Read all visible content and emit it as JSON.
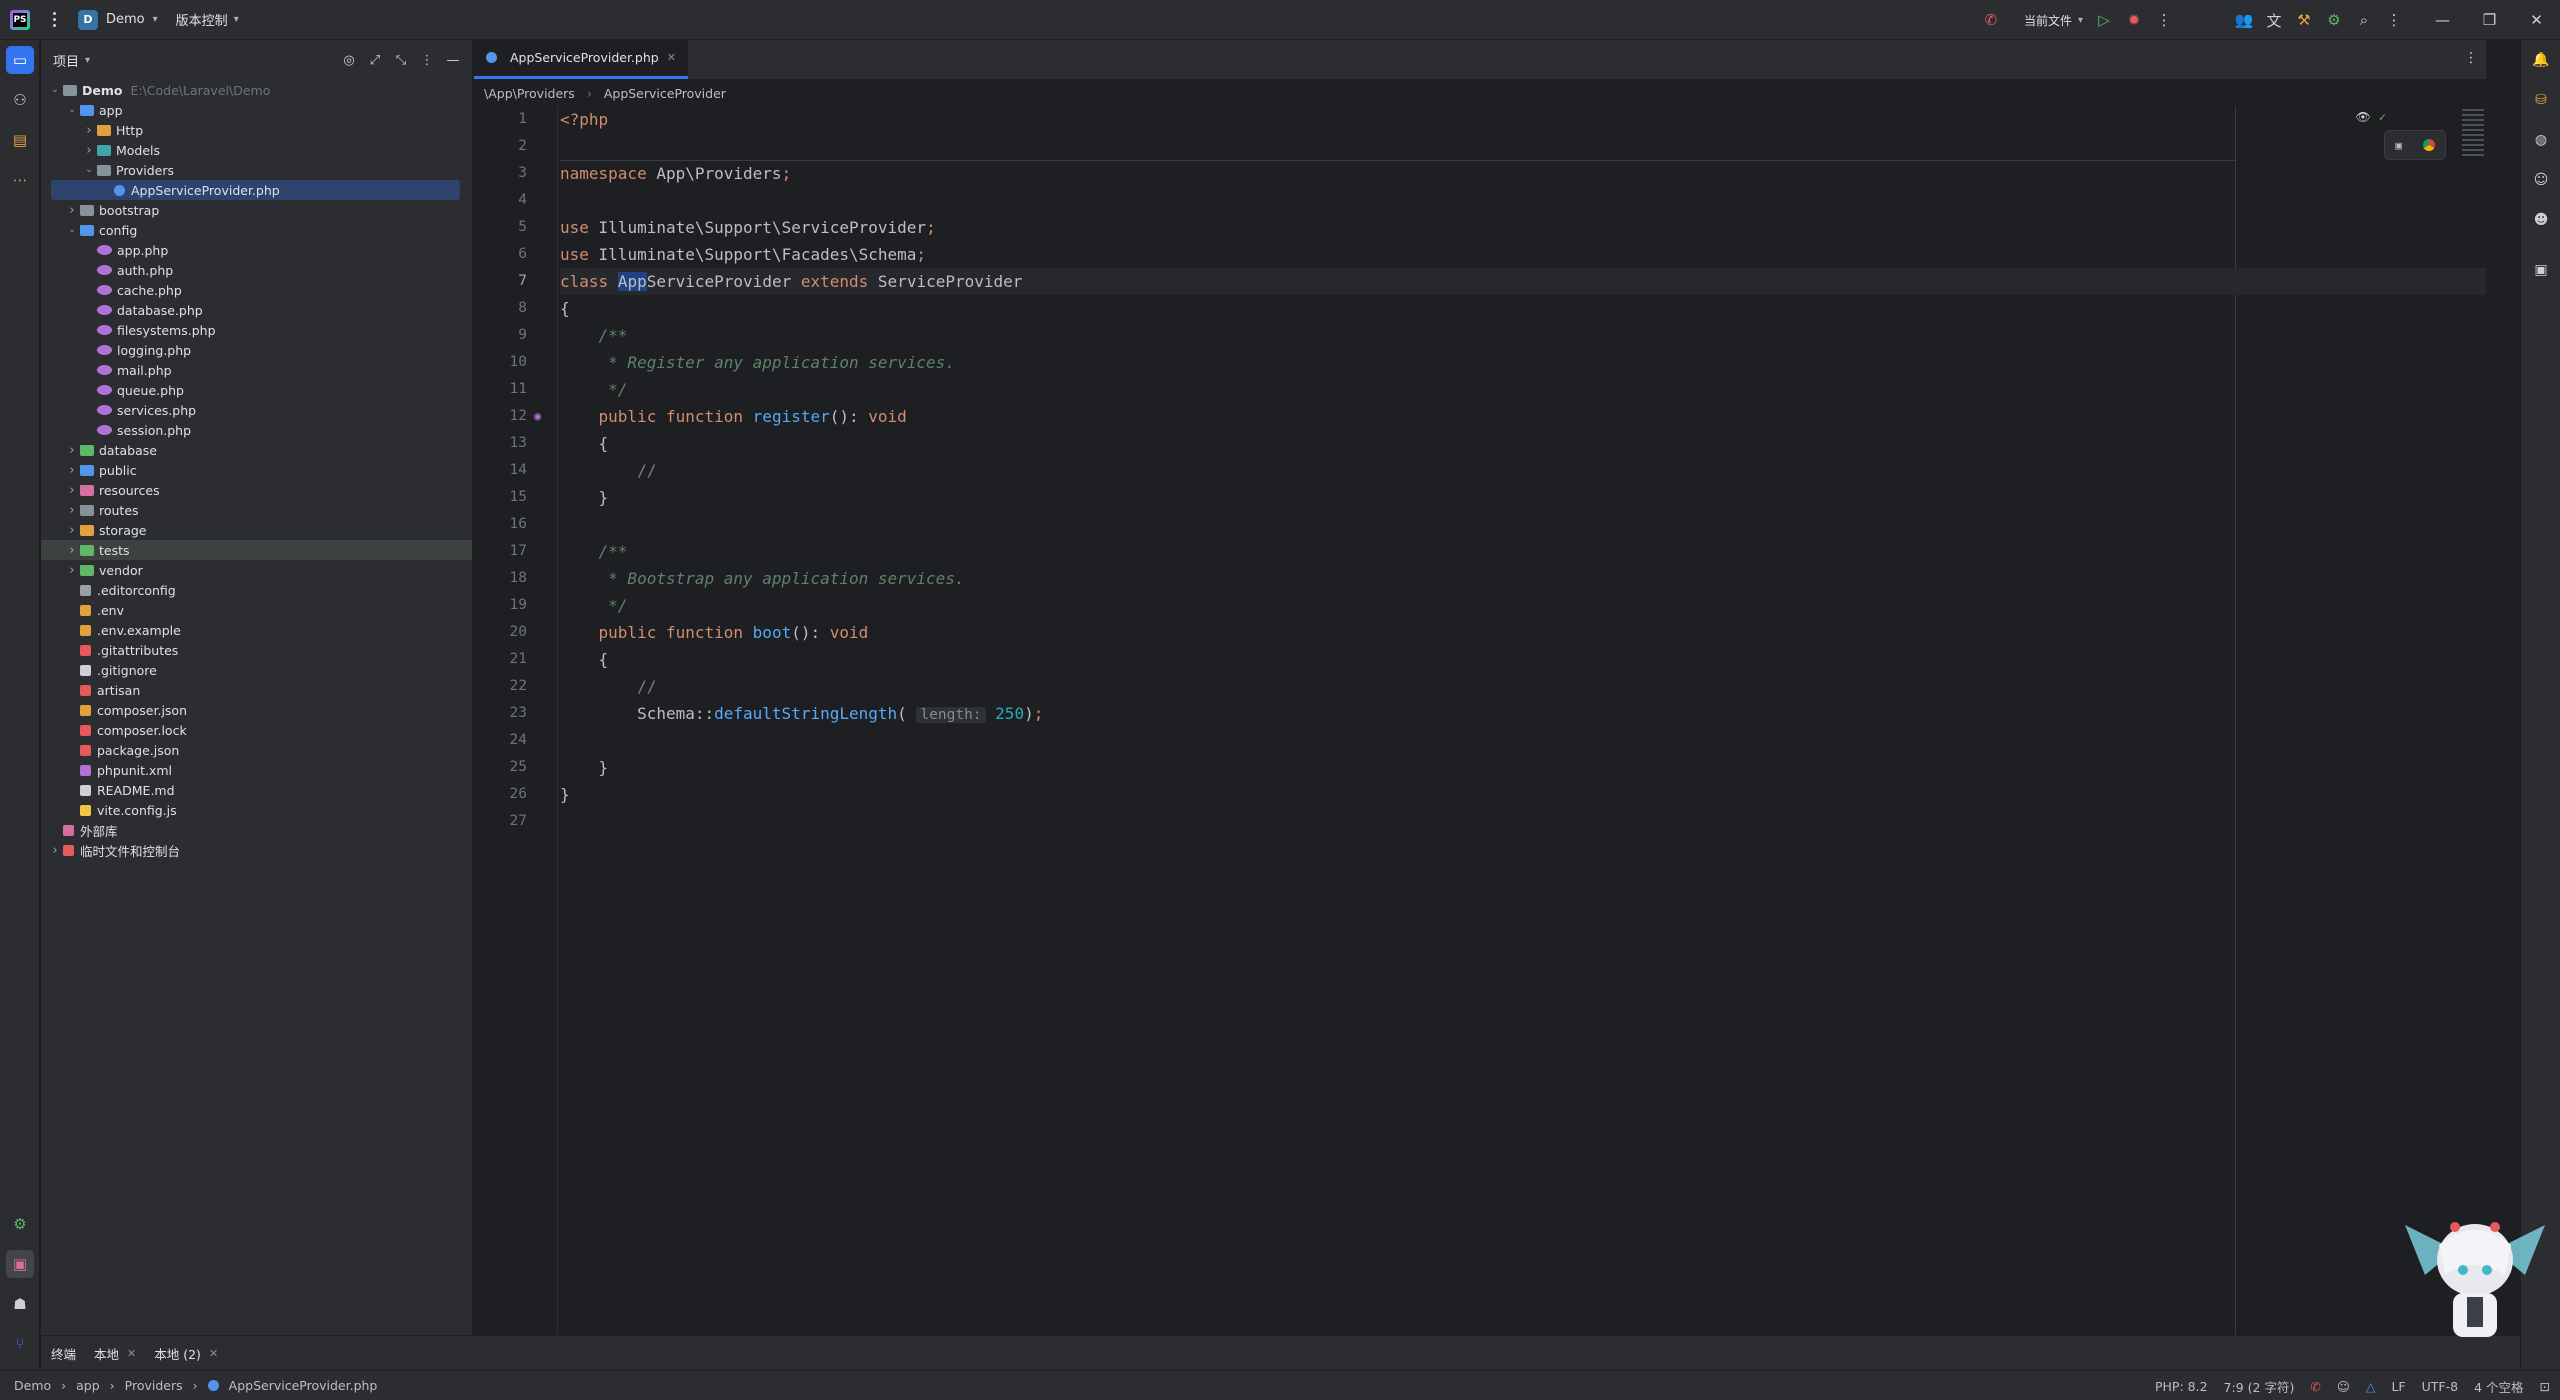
{
  "titlebar": {
    "project_badge": "D",
    "project_name": "Demo",
    "vcs_label": "版本控制",
    "run_config": "当前文件"
  },
  "project_panel": {
    "title": "项目",
    "root_name": "Demo",
    "root_path": "E:\\Code\\Laravel\\Demo",
    "tree": [
      {
        "label": "app",
        "depth": 1,
        "icon": "folder-blue",
        "expanded": true
      },
      {
        "label": "Http",
        "depth": 2,
        "icon": "folder-orange",
        "expanded": false
      },
      {
        "label": "Models",
        "depth": 2,
        "icon": "folder-teal",
        "expanded": false
      },
      {
        "label": "Providers",
        "depth": 2,
        "icon": "folder",
        "expanded": true
      },
      {
        "label": "AppServiceProvider.php",
        "depth": 3,
        "icon": "php-class",
        "selected": true
      },
      {
        "label": "bootstrap",
        "depth": 1,
        "icon": "folder",
        "expanded": false
      },
      {
        "label": "config",
        "depth": 1,
        "icon": "folder-blue",
        "expanded": true
      },
      {
        "label": "app.php",
        "depth": 2,
        "icon": "php"
      },
      {
        "label": "auth.php",
        "depth": 2,
        "icon": "php"
      },
      {
        "label": "cache.php",
        "depth": 2,
        "icon": "php"
      },
      {
        "label": "database.php",
        "depth": 2,
        "icon": "php"
      },
      {
        "label": "filesystems.php",
        "depth": 2,
        "icon": "php"
      },
      {
        "label": "logging.php",
        "depth": 2,
        "icon": "php"
      },
      {
        "label": "mail.php",
        "depth": 2,
        "icon": "php"
      },
      {
        "label": "queue.php",
        "depth": 2,
        "icon": "php"
      },
      {
        "label": "services.php",
        "depth": 2,
        "icon": "php"
      },
      {
        "label": "session.php",
        "depth": 2,
        "icon": "php"
      },
      {
        "label": "database",
        "depth": 1,
        "icon": "folder-green",
        "expanded": false
      },
      {
        "label": "public",
        "depth": 1,
        "icon": "folder-blue",
        "expanded": false
      },
      {
        "label": "resources",
        "depth": 1,
        "icon": "folder-pink",
        "expanded": false
      },
      {
        "label": "routes",
        "depth": 1,
        "icon": "folder",
        "expanded": false
      },
      {
        "label": "storage",
        "depth": 1,
        "icon": "folder-orange",
        "expanded": false
      },
      {
        "label": "tests",
        "depth": 1,
        "icon": "folder-green",
        "expanded": false,
        "highlight": true
      },
      {
        "label": "vendor",
        "depth": 1,
        "icon": "folder-green",
        "expanded": false
      },
      {
        "label": ".editorconfig",
        "depth": 1,
        "icon": "settings-file"
      },
      {
        "label": ".env",
        "depth": 1,
        "icon": "env-file"
      },
      {
        "label": ".env.example",
        "depth": 1,
        "icon": "env-file"
      },
      {
        "label": ".gitattributes",
        "depth": 1,
        "icon": "git-file"
      },
      {
        "label": ".gitignore",
        "depth": 1,
        "icon": "ignore-file"
      },
      {
        "label": "artisan",
        "depth": 1,
        "icon": "artisan-file"
      },
      {
        "label": "composer.json",
        "depth": 1,
        "icon": "composer-file"
      },
      {
        "label": "composer.lock",
        "depth": 1,
        "icon": "lock-file"
      },
      {
        "label": "package.json",
        "depth": 1,
        "icon": "npm-file"
      },
      {
        "label": "phpunit.xml",
        "depth": 1,
        "icon": "xml-file"
      },
      {
        "label": "README.md",
        "depth": 1,
        "icon": "md-file"
      },
      {
        "label": "vite.config.js",
        "depth": 1,
        "icon": "vite-file"
      },
      {
        "label": "外部库",
        "depth": 0,
        "icon": "library"
      },
      {
        "label": "临时文件和控制台",
        "depth": 0,
        "icon": "scratch",
        "expanded": false
      }
    ]
  },
  "editor": {
    "tab_label": "AppServiceProvider.php",
    "breadcrumbs": [
      "\\App\\Providers",
      "AppServiceProvider"
    ],
    "current_line": 7,
    "lines": [
      "<?php",
      "",
      "namespace App\\Providers;",
      "",
      "use Illuminate\\Support\\ServiceProvider;",
      "use Illuminate\\Support\\Facades\\Schema;",
      "class AppServiceProvider extends ServiceProvider",
      "{",
      "    /**",
      "     * Register any application services.",
      "     */",
      "    public function register(): void",
      "    {",
      "        //",
      "    }",
      "",
      "    /**",
      "     * Bootstrap any application services.",
      "     */",
      "    public function boot(): void",
      "    {",
      "        //",
      "        Schema::defaultStringLength( length: 250);",
      "",
      "    }",
      "}",
      ""
    ]
  },
  "bottom_tabs": [
    {
      "label": "终端",
      "closable": false
    },
    {
      "label": "本地",
      "closable": true
    },
    {
      "label": "本地 (2)",
      "closable": true
    }
  ],
  "statusbar": {
    "crumbs": [
      "Demo",
      "app",
      "Providers",
      "AppServiceProvider.php"
    ],
    "php_version": "PHP: 8.2",
    "position": "7:9 (2 字符)",
    "line_sep": "LF",
    "encoding": "UTF-8",
    "indent": "4 个空格"
  },
  "colors": {
    "accent": "#3574f0",
    "keyword": "#cf8e6d",
    "function": "#56a8f5",
    "comment": "#5f826b",
    "number": "#2aacb8"
  }
}
